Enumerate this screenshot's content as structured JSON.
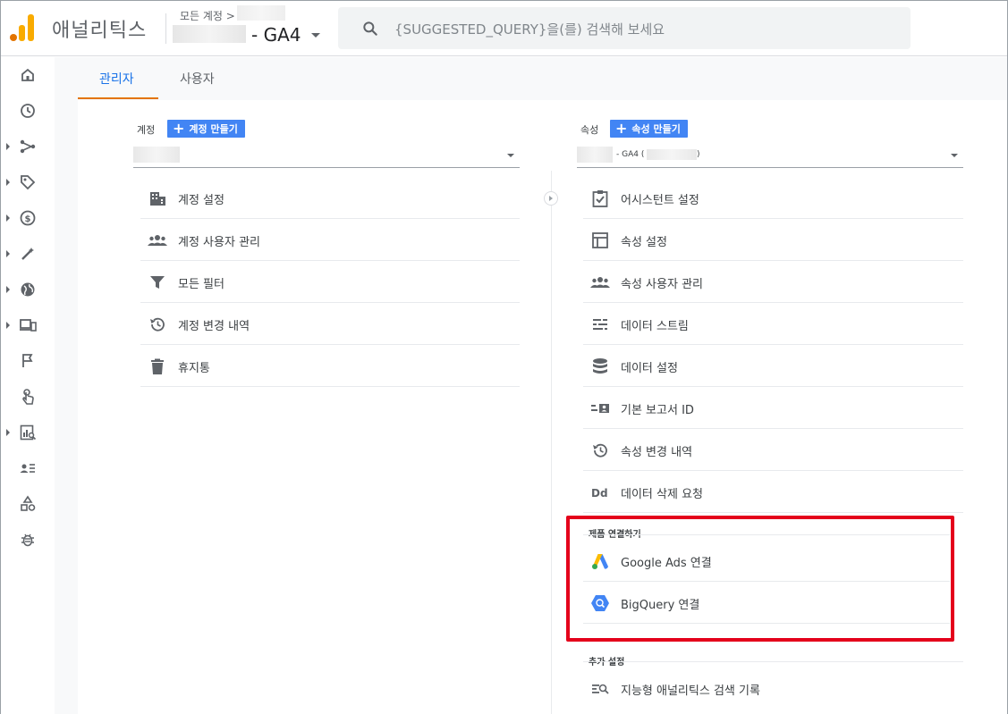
{
  "header": {
    "app_title": "애널리틱스",
    "breadcrumb": "모든 계정 >",
    "property_name": "- GA4",
    "search_placeholder": "{SUGGESTED_QUERY}을(를) 검색해 보세요"
  },
  "rail": {
    "items": [
      {
        "icon": "home-icon",
        "expandable": false
      },
      {
        "icon": "clock-icon",
        "expandable": false
      },
      {
        "icon": "branch-icon",
        "expandable": true
      },
      {
        "icon": "tag-icon",
        "expandable": true
      },
      {
        "icon": "dollar-icon",
        "expandable": true
      },
      {
        "icon": "magic-wand-icon",
        "expandable": true
      },
      {
        "icon": "globe-icon",
        "expandable": true
      },
      {
        "icon": "devices-icon",
        "expandable": true
      },
      {
        "icon": "flag-icon",
        "expandable": false
      },
      {
        "icon": "touch-icon",
        "expandable": false
      },
      {
        "icon": "report-search-icon",
        "expandable": true
      },
      {
        "icon": "audience-list-icon",
        "expandable": false
      },
      {
        "icon": "shapes-icon",
        "expandable": false
      },
      {
        "icon": "bug-icon",
        "expandable": false
      }
    ]
  },
  "tabs": {
    "admin": "관리자",
    "user": "사용자"
  },
  "account": {
    "label": "계정",
    "create_button": "계정 만들기",
    "items": [
      {
        "label": "계정 설정",
        "icon": "building-icon"
      },
      {
        "label": "계정 사용자 관리",
        "icon": "people-icon"
      },
      {
        "label": "모든 필터",
        "icon": "filter-icon"
      },
      {
        "label": "계정 변경 내역",
        "icon": "history-icon"
      },
      {
        "label": "휴지통",
        "icon": "trash-icon"
      }
    ]
  },
  "property": {
    "label": "속성",
    "create_button": "속성 만들기",
    "selected_prefix": "- GA4 (",
    "selected_suffix": ")",
    "items": [
      {
        "label": "어시스턴트 설정",
        "icon": "clipboard-check-icon"
      },
      {
        "label": "속성 설정",
        "icon": "layout-icon"
      },
      {
        "label": "속성 사용자 관리",
        "icon": "people-icon"
      },
      {
        "label": "데이터 스트림",
        "icon": "stream-icon"
      },
      {
        "label": "데이터 설정",
        "icon": "database-icon"
      },
      {
        "label": "기본 보고서 ID",
        "icon": "id-card-icon"
      },
      {
        "label": "속성 변경 내역",
        "icon": "history-icon"
      },
      {
        "label": "데이터 삭제 요청",
        "icon": "dd-icon"
      }
    ],
    "product_links": {
      "title": "제품 연결하기",
      "items": [
        {
          "label": "Google Ads 연결",
          "icon": "google-ads-icon"
        },
        {
          "label": "BigQuery 연결",
          "icon": "bigquery-icon"
        }
      ]
    },
    "additional": {
      "title": "추가 설정",
      "items": [
        {
          "label": "지능형 애널리틱스 검색 기록",
          "icon": "search-history-icon"
        }
      ]
    }
  },
  "colors": {
    "accent": "#1a73e8",
    "tab_underline": "#e37400",
    "create_button": "#4285f4",
    "highlight": "#e4001b"
  }
}
